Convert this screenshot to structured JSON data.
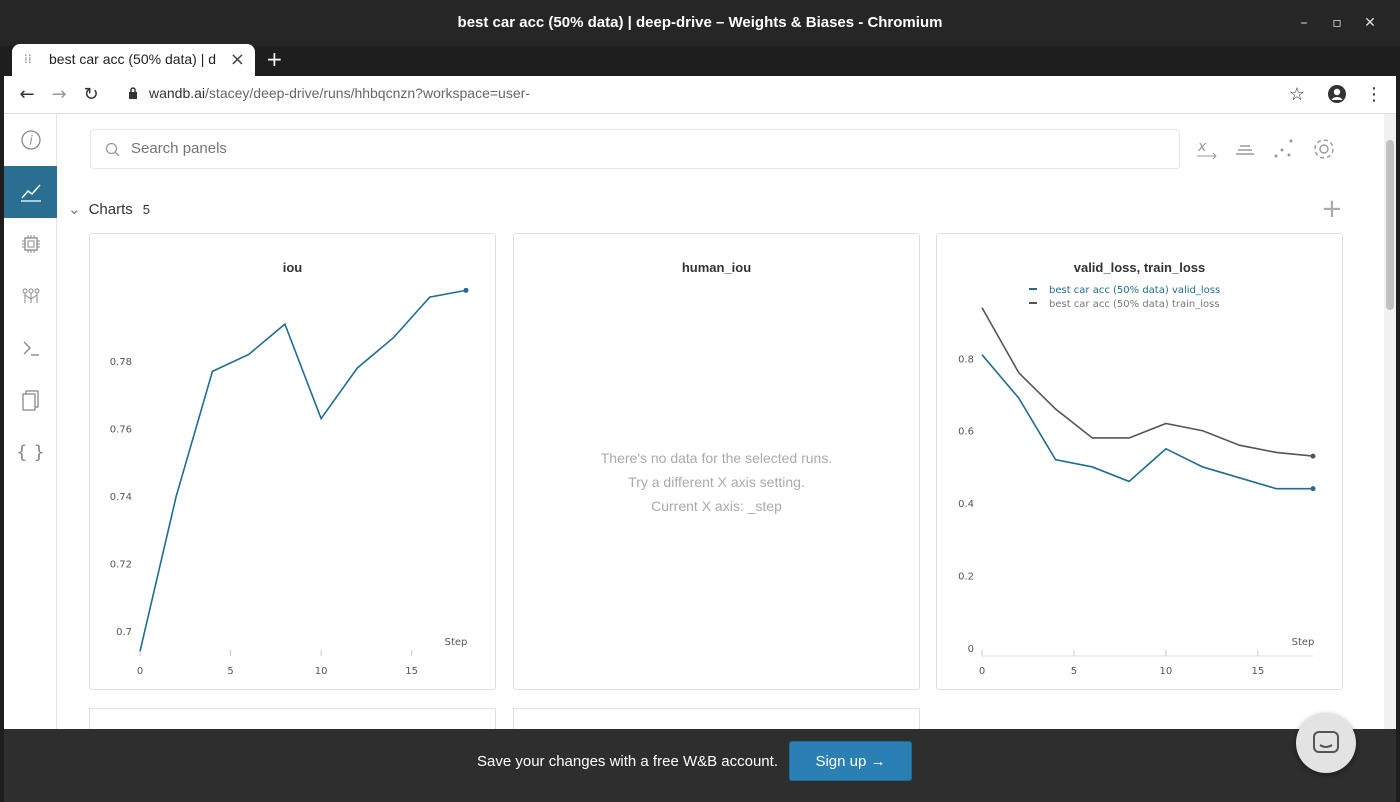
{
  "window": {
    "title": "best car acc (50% data) | deep-drive – Weights & Biases - Chromium"
  },
  "tab": {
    "title": "best car acc (50% data) | d",
    "close": "×",
    "new": "+"
  },
  "address": {
    "domain": "wandb.ai",
    "path": "/stacey/deep-drive/runs/hhbqcnzn?workspace=user-"
  },
  "search": {
    "placeholder": "Search panels"
  },
  "section": {
    "label": "Charts",
    "count": "5"
  },
  "panels": [
    {
      "title": "iou"
    },
    {
      "title": "human_iou",
      "empty_lines": [
        "There's no data for the selected runs.",
        "Try a different X axis setting.",
        "Current X axis: _step"
      ]
    },
    {
      "title": "valid_loss, train_loss"
    }
  ],
  "banner": {
    "text": "Save your changes with a free W&B account.",
    "button": "Sign up"
  },
  "colors": {
    "series_blue": "#1f6d8f",
    "series_gray": "#555555",
    "sidebar_active": "#2a6f92",
    "signup": "#2a7fb3"
  },
  "chart_data": [
    {
      "type": "line",
      "title": "iou",
      "xlabel": "Step",
      "xticks": [
        "0",
        "5",
        "10",
        "15"
      ],
      "yticks": [
        "0.7",
        "0.72",
        "0.74",
        "0.76",
        "0.78"
      ],
      "xlim": [
        0,
        18
      ],
      "ylim": [
        0.695,
        0.802
      ],
      "series": [
        {
          "x": [
            0,
            2,
            4,
            6,
            8,
            10,
            12,
            14,
            16,
            18
          ],
          "y": [
            0.694,
            0.74,
            0.777,
            0.782,
            0.791,
            0.763,
            0.778,
            0.787,
            0.799,
            0.801
          ]
        }
      ]
    },
    {
      "type": "line",
      "title": "valid_loss, train_loss",
      "xlabel": "Step",
      "xticks": [
        "0",
        "5",
        "10",
        "15"
      ],
      "yticks": [
        "0",
        "0.2",
        "0.4",
        "0.6",
        "0.8"
      ],
      "xlim": [
        0,
        18
      ],
      "ylim": [
        0,
        0.95
      ],
      "legend": "top",
      "series": [
        {
          "name": "best car acc (50% data) valid_loss",
          "x": [
            0,
            2,
            4,
            6,
            8,
            10,
            12,
            14,
            16,
            18
          ],
          "y": [
            0.81,
            0.69,
            0.52,
            0.5,
            0.46,
            0.55,
            0.5,
            0.47,
            0.44,
            0.44
          ]
        },
        {
          "name": "best car acc (50% data) train_loss",
          "x": [
            0,
            2,
            4,
            6,
            8,
            10,
            12,
            14,
            16,
            18
          ],
          "y": [
            0.94,
            0.76,
            0.66,
            0.58,
            0.58,
            0.62,
            0.6,
            0.56,
            0.54,
            0.53
          ]
        }
      ]
    }
  ]
}
